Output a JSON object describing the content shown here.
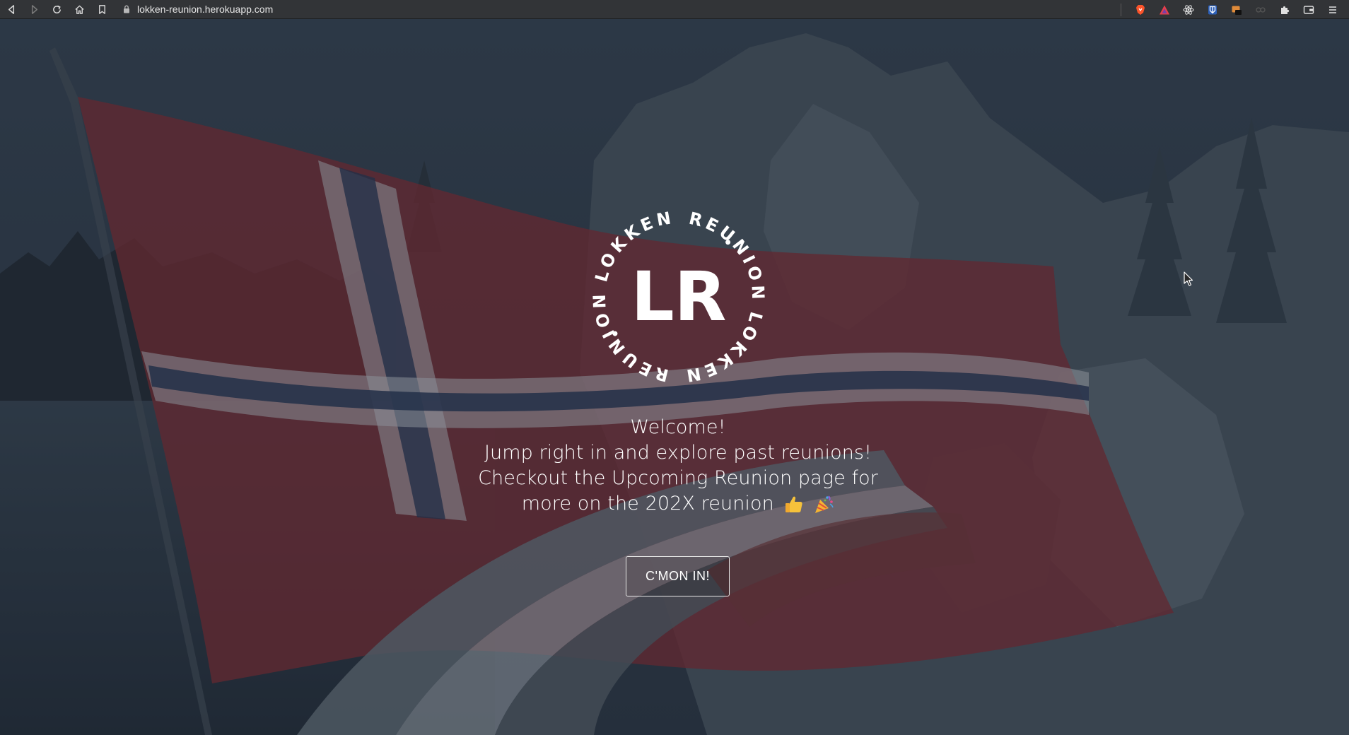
{
  "browser": {
    "url": "lokken-reunion.herokuapp.com",
    "nav_icons": [
      "back-icon",
      "forward-icon",
      "reload-icon",
      "home-icon",
      "bookmark-icon"
    ],
    "extension_icons": [
      "brave-shields-icon",
      "brave-rewards-icon",
      "react-devtools-icon",
      "bitwarden-icon",
      "extension-icon",
      "extension-icon",
      "puzzle-icon",
      "wallet-icon",
      "menu-icon"
    ]
  },
  "logo": {
    "monogram": "LR",
    "ring_top": "REUNION",
    "ring_right": "LOKKEN",
    "ring_bottom": "REUNION",
    "ring_left": "LOKKEN"
  },
  "hero": {
    "line1": "Welcome!",
    "line2": "Jump right in and explore past reunions!",
    "line3": "Checkout the Upcoming Reunion page for",
    "line4": "more on the 202X reunion",
    "emojis": [
      "thumbs-up-icon",
      "party-popper-icon"
    ],
    "cta_label": "C'MON IN!"
  },
  "colors": {
    "flag_red": "#8a2f34",
    "flag_blue": "#2c3a58",
    "flag_white": "#c9ccd2",
    "overlay": "#1e2a36",
    "text": "#ffffff"
  }
}
